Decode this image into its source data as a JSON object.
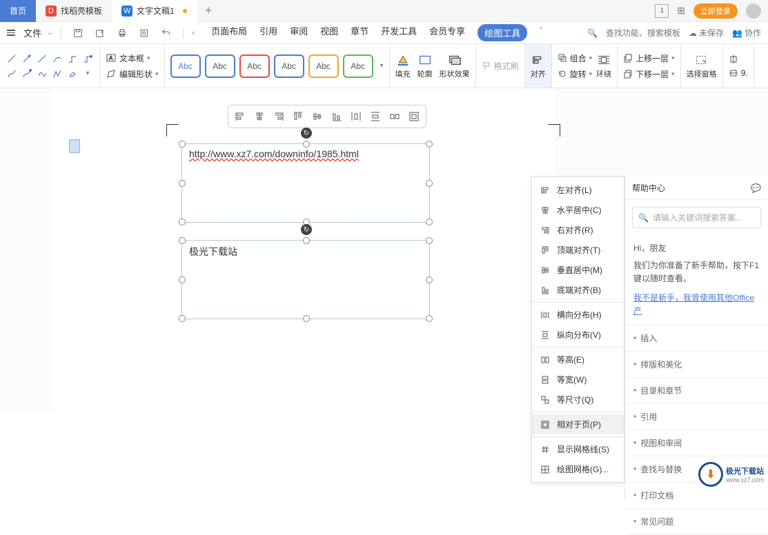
{
  "tabs": {
    "home": "首页",
    "t1": "找稻壳模板",
    "t2": "文字文稿1",
    "login": "立即登录"
  },
  "menu": {
    "file": "文件",
    "items": [
      "页面布局",
      "引用",
      "审阅",
      "视图",
      "章节",
      "开发工具",
      "会员专享",
      "绘图工具"
    ],
    "search": "查找功能、搜索模板",
    "unsaved": "未保存",
    "coop": "协作"
  },
  "ribbon": {
    "textbox": "文本框",
    "editshape": "编辑形状",
    "abc": [
      "Abc",
      "Abc",
      "Abc",
      "Abc",
      "Abc",
      "Abc"
    ],
    "fill": "填充",
    "outline": "轮廓",
    "effect": "形状效果",
    "formatbrush": "格式刷",
    "align": "对齐",
    "group": "组合",
    "rotate": "旋转",
    "wrap": "环绕",
    "moveup": "上移一层",
    "movedown": "下移一层",
    "selectpane": "选择窗格",
    "size": "9."
  },
  "canvas": {
    "url": "http://www.xz7.com/downinfo/1985.html",
    "text2": "极光下载站"
  },
  "dropdown": {
    "items": [
      "左对齐(L)",
      "水平居中(C)",
      "右对齐(R)",
      "顶端对齐(T)",
      "垂直居中(M)",
      "底端对齐(B)",
      "横向分布(H)",
      "纵向分布(V)",
      "等高(E)",
      "等宽(W)",
      "等尺寸(Q)",
      "相对于页(P)",
      "显示网格线(S)",
      "绘图网格(G)..."
    ]
  },
  "help": {
    "title": "帮助中心",
    "search_ph": "请输入关键词搜索答案...",
    "hi": "Hi，朋友",
    "body": "我们为你准备了新手帮助，按下F1键以随时查看。",
    "link": "我不是新手，我曾使用其他Office产",
    "cats": [
      "插入",
      "排版和美化",
      "目录和章节",
      "引用",
      "视图和审阅",
      "查找与替换",
      "打印文档",
      "常见问题"
    ]
  },
  "watermark": {
    "name": "极光下载站",
    "url": "www.xz7.com"
  }
}
